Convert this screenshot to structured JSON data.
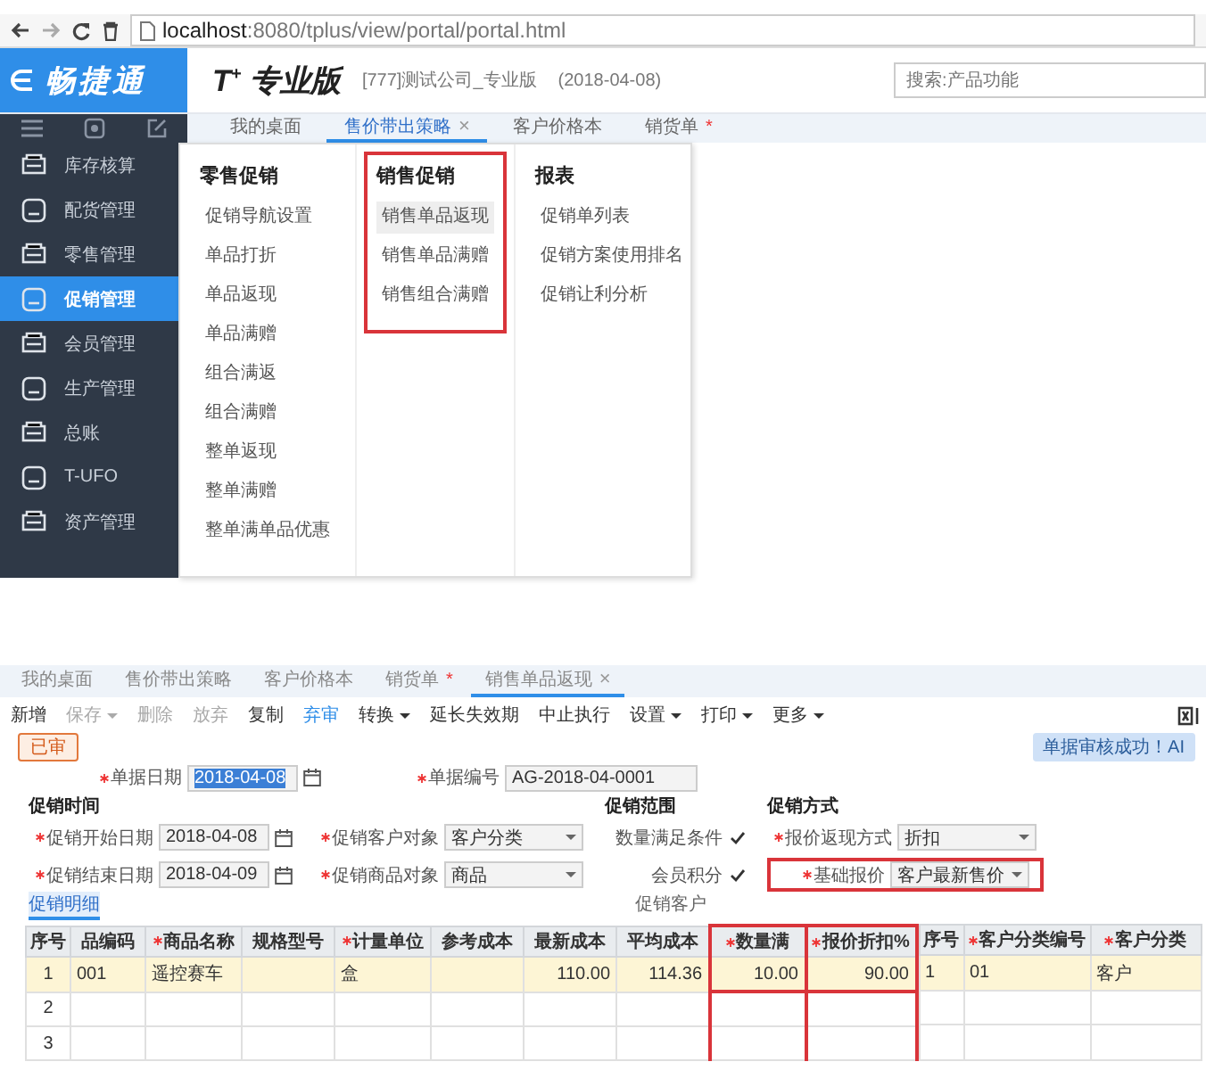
{
  "browser": {
    "url": "**localhost**:8080/tplus/view/portal/portal.html"
  },
  "header": {
    "logo": "畅捷通",
    "title": "T$^{+}$ 专业版",
    "company": "[777]测试公司_专业版",
    "date": "(2018-04-08)",
    "search": {
      "placeholder": "搜索:产品功能"
    }
  },
  "tabs": [
    {
      "label": "我的桌面",
      "selected": false
    },
    {
      "label": "售价带出策略",
      "selected": true,
      "close": "×"
    },
    {
      "label": "客户价格本",
      "selected": false
    },
    {
      "label": "销货单",
      "selected": false,
      "mark": "*"
    }
  ],
  "sidebar": {
    "items": [
      {
        "label": "库存核算",
        "selected": false
      },
      {
        "label": "配货管理",
        "selected": false
      },
      {
        "label": "零售管理",
        "selected": false
      },
      {
        "label": "促销管理",
        "selected": true
      },
      {
        "label": "会员管理",
        "selected": false
      },
      {
        "label": "生产管理",
        "selected": false
      },
      {
        "label": "总账",
        "selected": false
      },
      {
        "label": "T-UFO",
        "selected": false
      },
      {
        "label": "资产管理",
        "selected": false
      }
    ]
  },
  "menu": {
    "columns": [
      {
        "heading": "零售促销",
        "annotated": false,
        "items": [
          {
            "label": "促销导航设置",
            "selected": false
          },
          {
            "label": "单品打折",
            "selected": false
          },
          {
            "label": "单品返现",
            "selected": false
          },
          {
            "label": "单品满赠",
            "selected": false
          },
          {
            "label": "组合满返",
            "selected": false
          },
          {
            "label": "组合满赠",
            "selected": false
          },
          {
            "label": "整单返现",
            "selected": false
          },
          {
            "label": "整单满赠",
            "selected": false
          },
          {
            "label": "整单满单品优惠",
            "selected": false
          }
        ]
      },
      {
        "heading": "销售促销",
        "annotated": true,
        "items": [
          {
            "label": "销售单品返现",
            "selected": true
          },
          {
            "label": "销售单品满赠",
            "selected": false
          },
          {
            "label": "销售组合满赠",
            "selected": false
          }
        ]
      },
      {
        "heading": "报表",
        "annotated": false,
        "items": [
          {
            "label": "促销单列表",
            "selected": false
          },
          {
            "label": "促销方案使用排名",
            "selected": false
          },
          {
            "label": "促销让利分析",
            "selected": false
          }
        ]
      }
    ]
  },
  "doc_tabs": [
    {
      "label": "我的桌面",
      "selected": false
    },
    {
      "label": "售价带出策略",
      "selected": false
    },
    {
      "label": "客户价格本",
      "selected": false
    },
    {
      "label": "销货单",
      "selected": false,
      "mark": "*"
    },
    {
      "label": "销售单品返现",
      "selected": true,
      "close": "×"
    }
  ],
  "toolbar": [
    {
      "label": "新增",
      "dropdown": false,
      "disabled": false,
      "highlighted": false
    },
    {
      "label": "保存",
      "dropdown": true,
      "disabled": true,
      "highlighted": false
    },
    {
      "label": "删除",
      "dropdown": false,
      "disabled": true,
      "highlighted": false
    },
    {
      "label": "放弃",
      "dropdown": false,
      "disabled": true,
      "highlighted": false
    },
    {
      "label": "复制",
      "dropdown": false,
      "disabled": false,
      "highlighted": false
    },
    {
      "label": "弃审",
      "dropdown": false,
      "disabled": false,
      "highlighted": true
    },
    {
      "label": "转换",
      "dropdown": true,
      "disabled": false,
      "highlighted": false
    },
    {
      "label": "延长失效期",
      "dropdown": false,
      "disabled": false,
      "highlighted": false
    },
    {
      "label": "中止执行",
      "dropdown": false,
      "disabled": false,
      "highlighted": false
    },
    {
      "label": "设置",
      "dropdown": true,
      "disabled": false,
      "highlighted": false
    },
    {
      "label": "打印",
      "dropdown": true,
      "disabled": false,
      "highlighted": false
    },
    {
      "label": "更多",
      "dropdown": true,
      "disabled": false,
      "highlighted": false
    }
  ],
  "status": {
    "label": "已审"
  },
  "notice": "单据审核成功！AI",
  "form": {
    "top_fields": [
      {
        "kind": "date",
        "label": "单据日期",
        "required": true,
        "value": "2018-04-08",
        "selected": true,
        "annotated": false
      },
      {
        "kind": "text",
        "label": "单据编号",
        "required": true,
        "value": "AG-2018-04-0001",
        "annotated": false
      }
    ],
    "sections": [
      {
        "title": "促销时间",
        "fields": [
          {
            "kind": "date",
            "label": "促销开始日期",
            "required": true,
            "value": "2018-04-08",
            "selected": false,
            "annotated": false
          },
          {
            "kind": "date",
            "label": "促销结束日期",
            "required": true,
            "value": "2018-04-09",
            "selected": false,
            "annotated": false
          }
        ]
      },
      {
        "fields": [
          {
            "kind": "select",
            "label": "促销客户对象",
            "required": true,
            "value": "客户分类",
            "annotated": false
          },
          {
            "kind": "select",
            "label": "促销商品对象",
            "required": true,
            "value": "商品",
            "annotated": false
          }
        ]
      },
      {
        "title": "促销范围",
        "fields": [
          {
            "kind": "check",
            "label": "数量满足条件",
            "checked": true,
            "annotated": false
          },
          {
            "kind": "check",
            "label": "会员积分",
            "checked": true,
            "annotated": false
          }
        ]
      },
      {
        "title": "促销方式",
        "fields": [
          {
            "kind": "select",
            "label": "报价返现方式",
            "required": true,
            "value": "折扣",
            "annotated": false
          },
          {
            "kind": "select",
            "label": "基础报价",
            "required": true,
            "value": "客户最新售价",
            "annotated": true
          }
        ]
      }
    ]
  },
  "detail_tabs": [
    {
      "label": "促销明细",
      "selected": true
    },
    {
      "label": "促销客户",
      "selected": false
    }
  ],
  "table": {
    "columns": [
      {
        "label": "序号",
        "required": false,
        "annotated": false
      },
      {
        "label": "品编码",
        "required": false,
        "annotated": false
      },
      {
        "label": "商品名称",
        "required": true,
        "annotated": false
      },
      {
        "label": "规格型号",
        "required": false,
        "annotated": false
      },
      {
        "label": "计量单位",
        "required": true,
        "annotated": false
      },
      {
        "label": "参考成本",
        "required": false,
        "annotated": false
      },
      {
        "label": "最新成本",
        "required": false,
        "annotated": false
      },
      {
        "label": "平均成本",
        "required": false,
        "annotated": false
      },
      {
        "label": "数量满",
        "required": true,
        "annotated": true
      },
      {
        "label": "报价折扣%",
        "required": true,
        "annotated": true
      }
    ],
    "rows": [
      {
        "selected": true,
        "cells": [
          "1",
          "001",
          "遥控赛车",
          "",
          "盒",
          "",
          "110.00",
          "114.36",
          "10.00",
          "90.00"
        ]
      },
      {
        "selected": false,
        "cells": [
          "2",
          "",
          "",
          "",
          "",
          "",
          "",
          "",
          "",
          ""
        ]
      },
      {
        "selected": false,
        "cells": [
          "3",
          "",
          "",
          "",
          "",
          "",
          "",
          "",
          "",
          ""
        ]
      }
    ]
  },
  "customer_table": {
    "columns": [
      {
        "label": "序号",
        "required": false
      },
      {
        "label": "客户分类编号",
        "required": true
      },
      {
        "label": "客户分类",
        "required": true
      }
    ],
    "rows": [
      {
        "selected": true,
        "cells": [
          "1",
          "01",
          "客户"
        ]
      }
    ]
  }
}
